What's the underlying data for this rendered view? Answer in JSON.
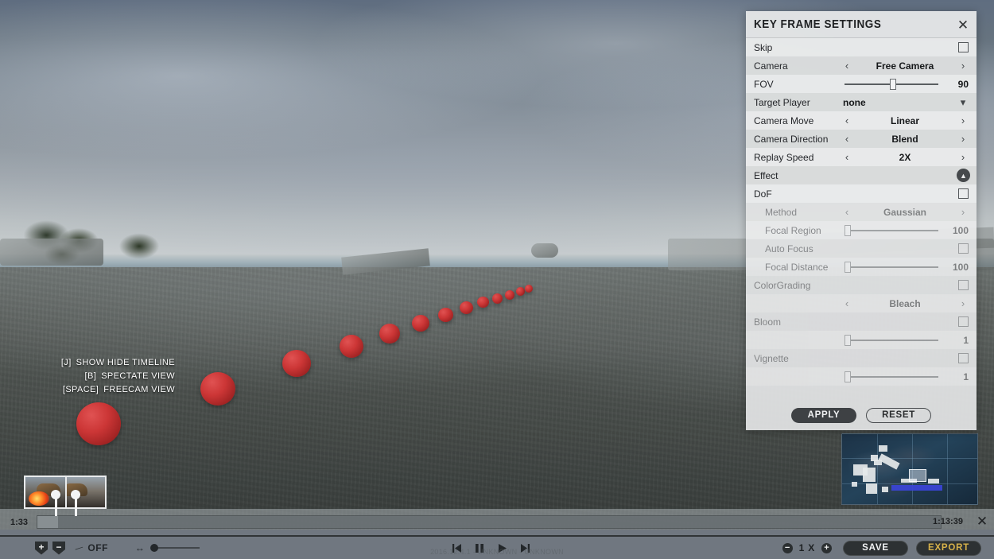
{
  "hints": [
    {
      "key": "[J]",
      "action": "SHOW HIDE TIMELINE"
    },
    {
      "key": "[B]",
      "action": "SPECTATE VIEW"
    },
    {
      "key": "[SPACE]",
      "action": "FREECAM VIEW"
    }
  ],
  "key_frame_settings": {
    "title": "KEY FRAME SETTINGS",
    "close_icon": "close-icon",
    "rows": [
      {
        "id": "skip",
        "label": "Skip",
        "type": "checkbox",
        "checked": false,
        "dim": false
      },
      {
        "id": "camera",
        "label": "Camera",
        "type": "stepper",
        "value": "Free Camera",
        "dim": false
      },
      {
        "id": "fov",
        "label": "FOV",
        "type": "slider",
        "value": "90",
        "pct": 52,
        "dim": false
      },
      {
        "id": "target-player",
        "label": "Target Player",
        "type": "dropdown",
        "value": "none",
        "dim": false
      },
      {
        "id": "camera-move",
        "label": "Camera Move",
        "type": "stepper",
        "value": "Linear",
        "dim": false
      },
      {
        "id": "camera-direction",
        "label": "Camera Direction",
        "type": "stepper",
        "value": "Blend",
        "dim": false
      },
      {
        "id": "replay-speed",
        "label": "Replay Speed",
        "type": "stepper",
        "value": "2X",
        "dim": false
      },
      {
        "id": "effect",
        "label": "Effect",
        "type": "section",
        "collapse_icon": "chevron-up-icon",
        "dim": false
      },
      {
        "id": "dof",
        "label": "DoF",
        "type": "checkbox",
        "checked": false,
        "dim": false
      },
      {
        "id": "method",
        "label": "Method",
        "type": "stepper",
        "value": "Gaussian",
        "indent": true,
        "dim": true
      },
      {
        "id": "focal-region",
        "label": "Focal Region",
        "type": "slider",
        "value": "100",
        "pct": 3,
        "indent": true,
        "dim": true
      },
      {
        "id": "auto-focus",
        "label": "Auto Focus",
        "type": "checkbox",
        "checked": false,
        "indent": true,
        "dim": true
      },
      {
        "id": "focal-distance",
        "label": "Focal Distance",
        "type": "slider",
        "value": "100",
        "pct": 3,
        "indent": true,
        "dim": true
      },
      {
        "id": "colorgrading",
        "label": "ColorGrading",
        "type": "checkbox",
        "checked": false,
        "dim": true
      },
      {
        "id": "colorgrading-mode",
        "label": "",
        "type": "stepper",
        "value": "Bleach",
        "dim": true
      },
      {
        "id": "bloom",
        "label": "Bloom",
        "type": "checkbox",
        "checked": false,
        "dim": true
      },
      {
        "id": "bloom-amount",
        "label": "",
        "type": "slider",
        "value": "1",
        "pct": 3,
        "dim": true
      },
      {
        "id": "vignette",
        "label": "Vignette",
        "type": "checkbox",
        "checked": false,
        "dim": true
      },
      {
        "id": "vignette-amount",
        "label": "",
        "type": "slider",
        "value": "1",
        "pct": 3,
        "dim": true
      }
    ],
    "apply_label": "APPLY",
    "reset_label": "RESET"
  },
  "timeline": {
    "start_time": "1:33",
    "end_time": "1:13:39",
    "close_icon": "close-icon",
    "keyframe_add_label": "+",
    "keyframe_remove_label": "−",
    "slowmo_label": "OFF",
    "slowmo_icon": "slow-motion-icon",
    "resize_icon": "↔",
    "transport": {
      "prev_icon": "skip-previous-icon",
      "pause_icon": "pause-icon",
      "play_icon": "play-icon",
      "next_icon": "skip-next-icon"
    },
    "watermark": "2016.12.4.1 - UNKNOWN - UNKNOWN",
    "zoom_out_label": "−",
    "zoom_level": "1 X",
    "zoom_in_label": "+",
    "save_label": "SAVE",
    "export_label": "EXPORT"
  },
  "colors": {
    "panel_bg": "#e8e9ea",
    "row_alt": "#d6d8d9",
    "accent_export": "#d8b24a",
    "sphere_red": "#cc3636",
    "minimap_zone": "#3b44d8"
  }
}
